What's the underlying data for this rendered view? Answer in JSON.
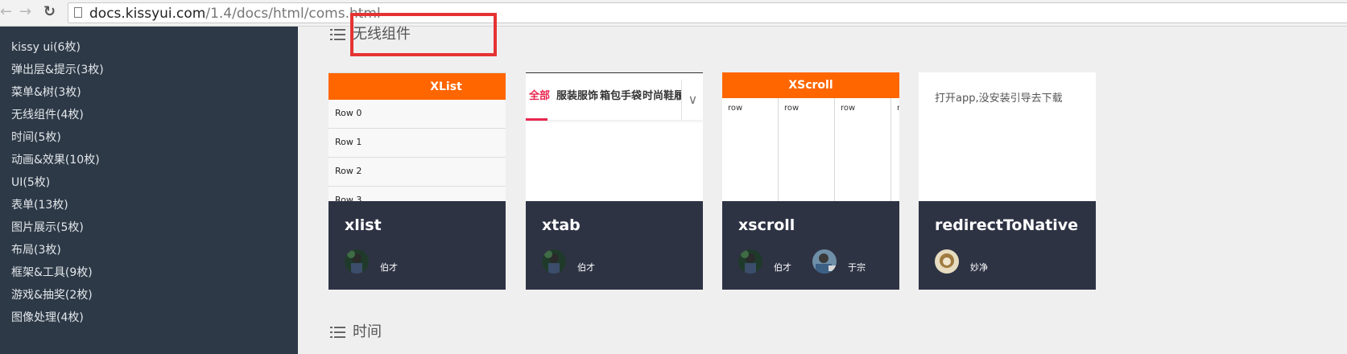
{
  "browser": {
    "url_domain": "docs.kissyui.com",
    "url_path": "/1.4/docs/html/coms.html",
    "back_icon": "back-arrow-icon",
    "forward_icon": "forward-arrow-icon",
    "reload_icon": "reload-icon"
  },
  "sidebar": {
    "items": [
      {
        "label": "kissy ui(6枚)"
      },
      {
        "label": "弹出层&提示(3枚)"
      },
      {
        "label": "菜单&树(3枚)"
      },
      {
        "label": "无线组件(4枚)"
      },
      {
        "label": "时间(5枚)"
      },
      {
        "label": "动画&效果(10枚)"
      },
      {
        "label": "UI(5枚)"
      },
      {
        "label": "表单(13枚)"
      },
      {
        "label": "图片展示(5枚)"
      },
      {
        "label": "布局(3枚)"
      },
      {
        "label": "框架&工具(9枚)"
      },
      {
        "label": "游戏&抽奖(2枚)"
      },
      {
        "label": "图像处理(4枚)"
      }
    ]
  },
  "sections": [
    {
      "title": "无线组件"
    },
    {
      "title": "时间"
    }
  ],
  "cards": [
    {
      "name": "xlist",
      "preview": {
        "bar_title": "XList",
        "rows": [
          "Row 0",
          "Row 1",
          "Row 2",
          "Row 3"
        ]
      },
      "authors": [
        "伯才"
      ]
    },
    {
      "name": "xtab",
      "preview": {
        "tabs": [
          "全部",
          "服装服饰",
          "箱包手袋",
          "时尚鞋履"
        ],
        "more": "∨"
      },
      "authors": [
        "伯才"
      ]
    },
    {
      "name": "xscroll",
      "preview": {
        "bar_title": "XScroll",
        "cols": [
          "row",
          "row",
          "row",
          "r"
        ]
      },
      "authors": [
        "伯才",
        "于宗"
      ]
    },
    {
      "name": "redirectToNative",
      "preview": {
        "text": "打开app,没安装引导去下载"
      },
      "authors": [
        "妙净"
      ]
    }
  ],
  "colors": {
    "sidebar_bg": "#2d3947",
    "card_footer_bg": "#2e3344",
    "accent_orange": "#ff6600",
    "highlight_red": "#e53333",
    "tab_active": "#e8264f"
  }
}
